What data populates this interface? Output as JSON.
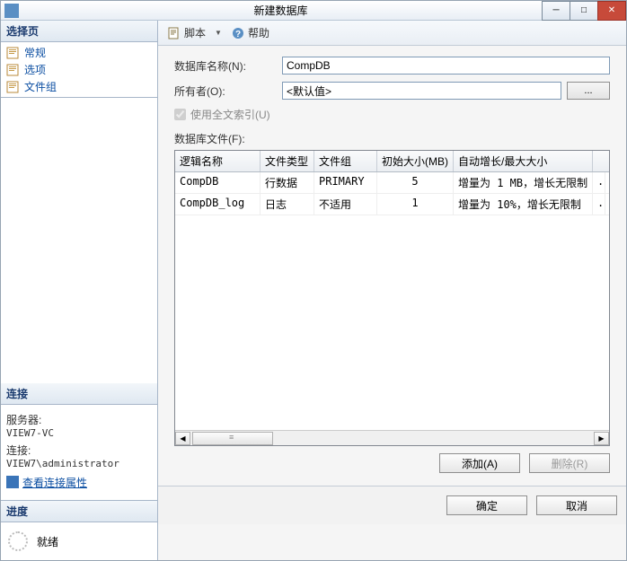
{
  "window": {
    "title": "新建数据库"
  },
  "win_buttons": {
    "min": "─",
    "max": "□",
    "close": "✕"
  },
  "left": {
    "select_page": "选择页",
    "nav": [
      {
        "label": "常规"
      },
      {
        "label": "选项"
      },
      {
        "label": "文件组"
      }
    ],
    "connection": {
      "header": "连接",
      "server_label": "服务器:",
      "server_value": "VIEW7-VC",
      "conn_label": "连接:",
      "conn_value": "VIEW7\\administrator",
      "view_props": "查看连接属性"
    },
    "progress": {
      "header": "进度",
      "status": "就绪"
    }
  },
  "toolbar": {
    "script": "脚本",
    "help": "帮助"
  },
  "form": {
    "db_name_label": "数据库名称(N):",
    "db_name_value": "CompDB",
    "owner_label": "所有者(O):",
    "owner_value": "<默认值>",
    "browse": "...",
    "fulltext_label": "使用全文索引(U)",
    "files_label": "数据库文件(F):"
  },
  "grid": {
    "headers": [
      "逻辑名称",
      "文件类型",
      "文件组",
      "初始大小(MB)",
      "自动增长/最大大小"
    ],
    "rows": [
      {
        "name": "CompDB",
        "type": "行数据",
        "filegroup": "PRIMARY",
        "size": "5",
        "growth": "增量为 1 MB，增长无限制",
        "dots": "."
      },
      {
        "name": "CompDB_log",
        "type": "日志",
        "filegroup": "不适用",
        "size": "1",
        "growth": "增量为 10%，增长无限制",
        "dots": "."
      }
    ]
  },
  "actions": {
    "add": "添加(A)",
    "remove": "删除(R)"
  },
  "footer": {
    "ok": "确定",
    "cancel": "取消"
  }
}
